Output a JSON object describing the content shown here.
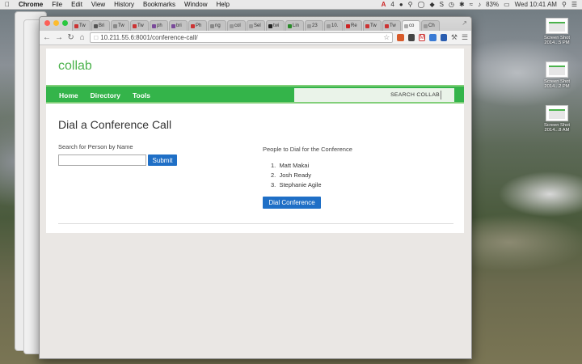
{
  "menubar": {
    "app": "Chrome",
    "menus": [
      "File",
      "Edit",
      "View",
      "History",
      "Bookmarks",
      "Window",
      "Help"
    ],
    "status_badge": "4",
    "battery": "83%",
    "clock": "Wed 10:41 AM"
  },
  "browser": {
    "tabs": [
      {
        "label": "Tw",
        "fav_color": "#c33"
      },
      {
        "label": "Bri",
        "fav_color": "#555"
      },
      {
        "label": "Tw",
        "fav_color": "#888"
      },
      {
        "label": "Tw",
        "fav_color": "#c33"
      },
      {
        "label": "ph",
        "fav_color": "#7a4a9a"
      },
      {
        "label": "bri",
        "fav_color": "#7a4a9a"
      },
      {
        "label": "Ph",
        "fav_color": "#c33"
      },
      {
        "label": "ng",
        "fav_color": "#888"
      },
      {
        "label": "col",
        "fav_color": "#999"
      },
      {
        "label": "Sel",
        "fav_color": "#999"
      },
      {
        "label": "twi",
        "fav_color": "#222"
      },
      {
        "label": "Lin",
        "fav_color": "#2a8a2a"
      },
      {
        "label": "23",
        "fav_color": "#999"
      },
      {
        "label": "10.",
        "fav_color": "#999"
      },
      {
        "label": "Re",
        "fav_color": "#c22"
      },
      {
        "label": "Tw",
        "fav_color": "#c33"
      },
      {
        "label": "Tw",
        "fav_color": "#c33"
      },
      {
        "label": "co",
        "fav_color": "#aaa",
        "active": true
      },
      {
        "label": "Ch",
        "fav_color": "#999"
      }
    ],
    "url": "10.211.55.6:8001/conference-call/"
  },
  "site": {
    "brand": "collab",
    "nav": [
      "Home",
      "Directory",
      "Tools"
    ],
    "search_label": "SEARCH COLLAB"
  },
  "page": {
    "title": "Dial a Conference Call",
    "search_label": "Search for Person by Name",
    "search_value": "",
    "submit_label": "Submit",
    "people_heading": "People to Dial for the Conference",
    "people": [
      "Matt Makai",
      "Josh Ready",
      "Stephanie Agile"
    ],
    "dial_label": "Dial Conference"
  },
  "desktop": {
    "icons": [
      {
        "label_line1": "Screen Shot",
        "label_line2": "2014...5 PM"
      },
      {
        "label_line1": "Screen Shot",
        "label_line2": "2014...2 PM"
      },
      {
        "label_line1": "Screen Shot",
        "label_line2": "2014...8 AM"
      }
    ]
  },
  "colors": {
    "brand_green": "#34b44a",
    "button_blue": "#1f6fc6"
  }
}
